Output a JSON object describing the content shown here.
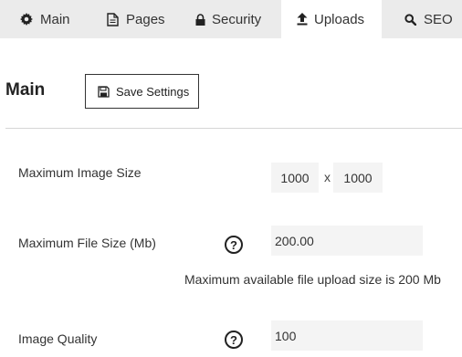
{
  "tabs": [
    {
      "label": "Main",
      "icon": "gear-icon"
    },
    {
      "label": "Pages",
      "icon": "document-icon"
    },
    {
      "label": "Security",
      "icon": "lock-icon"
    },
    {
      "label": "Uploads",
      "icon": "upload-icon",
      "active": true
    },
    {
      "label": "SEO",
      "icon": "search-icon"
    }
  ],
  "section": {
    "title": "Main",
    "save_label": "Save Settings",
    "save_icon": "floppy-disk-icon"
  },
  "settings": {
    "max_image_size": {
      "label": "Maximum Image Size",
      "width": "1000",
      "separator": "x",
      "height": "1000"
    },
    "max_file_size": {
      "label": "Maximum File Size (Mb)",
      "value": "200.00",
      "help": "?",
      "hint": "Maximum available file upload size is 200 Mb"
    },
    "image_quality": {
      "label": "Image Quality",
      "value": "100",
      "help": "?"
    }
  },
  "colors": {
    "tabbar_bg": "#ebebeb",
    "field_bg": "#f4f4f4",
    "active_tab_bg": "#ffffff"
  }
}
